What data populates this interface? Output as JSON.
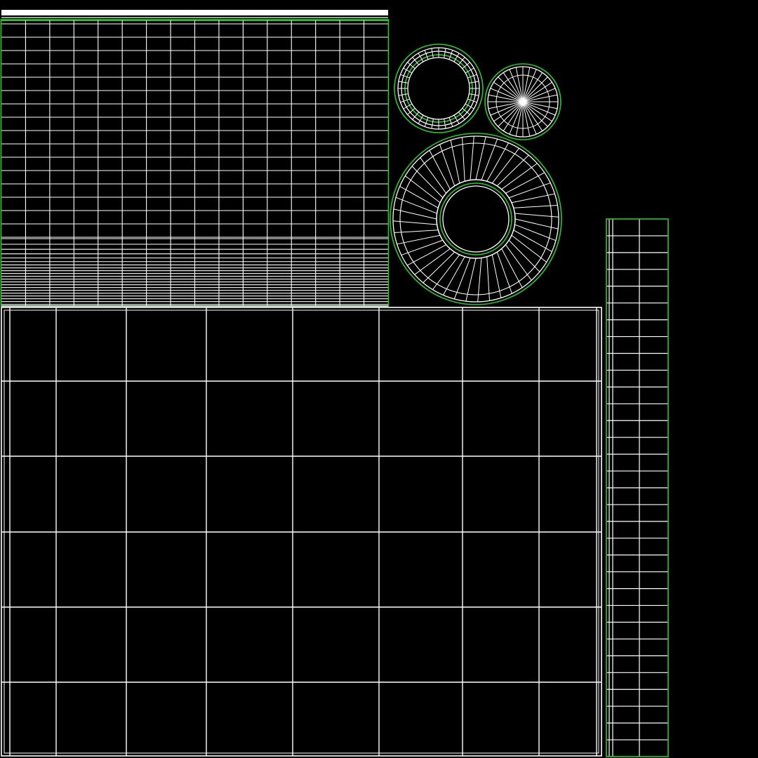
{
  "view": {
    "type": "uv-layout-wireframe",
    "background": "#000000",
    "wire_color": "#ffffff",
    "seam_color": "#22cc22"
  },
  "islands": [
    {
      "name": "top-left-dense-grid-island",
      "shape": "grid"
    },
    {
      "name": "large-bottom-square-grid-island",
      "shape": "grid"
    },
    {
      "name": "right-vertical-strip-island",
      "shape": "strip"
    },
    {
      "name": "small-ring-island",
      "shape": "ring"
    },
    {
      "name": "small-disc-fan-island",
      "shape": "disc"
    },
    {
      "name": "large-ring-island",
      "shape": "ring"
    }
  ]
}
